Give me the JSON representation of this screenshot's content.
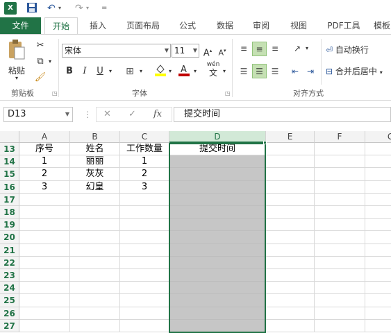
{
  "qat": {
    "app_icon": "X",
    "save_icon": "💾",
    "undo_icon": "↶",
    "redo_icon": "↷",
    "customize_icon": "⩡"
  },
  "tabs": [
    "文件",
    "开始",
    "插入",
    "页面布局",
    "公式",
    "数据",
    "审阅",
    "视图",
    "PDF工具",
    "模板"
  ],
  "ribbon": {
    "paste_label": "粘贴",
    "clipboard_label": "剪贴板",
    "font_name": "宋体",
    "font_size": "11",
    "bold": "B",
    "italic": "I",
    "underline": "U",
    "font_label": "字体",
    "wrap_text": "自动换行",
    "merge_center": "合并后居中",
    "alignment_label": "对齐方式",
    "phonetic": "wén"
  },
  "formula_bar": {
    "name_box": "D13",
    "fx": "fx",
    "cancel": "✕",
    "enter": "✓",
    "value": "提交时间"
  },
  "grid": {
    "columns": [
      "A",
      "B",
      "C",
      "D",
      "E",
      "F",
      "G"
    ],
    "rows": [
      "13",
      "14",
      "15",
      "16",
      "17",
      "18",
      "19",
      "20",
      "21",
      "22",
      "23",
      "24",
      "25",
      "26",
      "27"
    ],
    "data": [
      [
        "序号",
        "姓名",
        "工作数量",
        "提交时间"
      ],
      [
        "1",
        "丽丽",
        "1",
        ""
      ],
      [
        "2",
        "灰灰",
        "2",
        ""
      ],
      [
        "3",
        "幻皇",
        "3",
        ""
      ]
    ],
    "selected_column": "D",
    "accent": "#217346"
  }
}
